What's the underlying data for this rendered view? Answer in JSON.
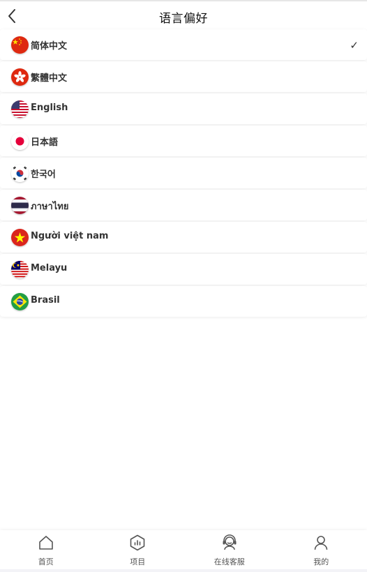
{
  "header": {
    "title": "语言偏好",
    "back_icon": "chevron-left-icon"
  },
  "languages": [
    {
      "label": "简体中文",
      "flag": "china-flag-icon",
      "selected": true
    },
    {
      "label": "繁體中文",
      "flag": "hongkong-flag-icon",
      "selected": false
    },
    {
      "label": "English",
      "flag": "usa-flag-icon",
      "selected": false
    },
    {
      "label": "日本語",
      "flag": "japan-flag-icon",
      "selected": false
    },
    {
      "label": "한국어",
      "flag": "korea-flag-icon",
      "selected": false
    },
    {
      "label": "ภาษาไทย",
      "flag": "thailand-flag-icon",
      "selected": false
    },
    {
      "label": "Người việt nam",
      "flag": "vietnam-flag-icon",
      "selected": false
    },
    {
      "label": "Melayu",
      "flag": "malaysia-flag-icon",
      "selected": false
    },
    {
      "label": "Brasil",
      "flag": "brazil-flag-icon",
      "selected": false
    }
  ],
  "selected_mark": "✓",
  "tabbar": {
    "items": [
      {
        "label": "首页",
        "icon": "home-icon"
      },
      {
        "label": "项目",
        "icon": "projects-icon"
      },
      {
        "label": "在线客服",
        "icon": "customer-service-icon"
      },
      {
        "label": "我的",
        "icon": "profile-icon"
      }
    ]
  }
}
